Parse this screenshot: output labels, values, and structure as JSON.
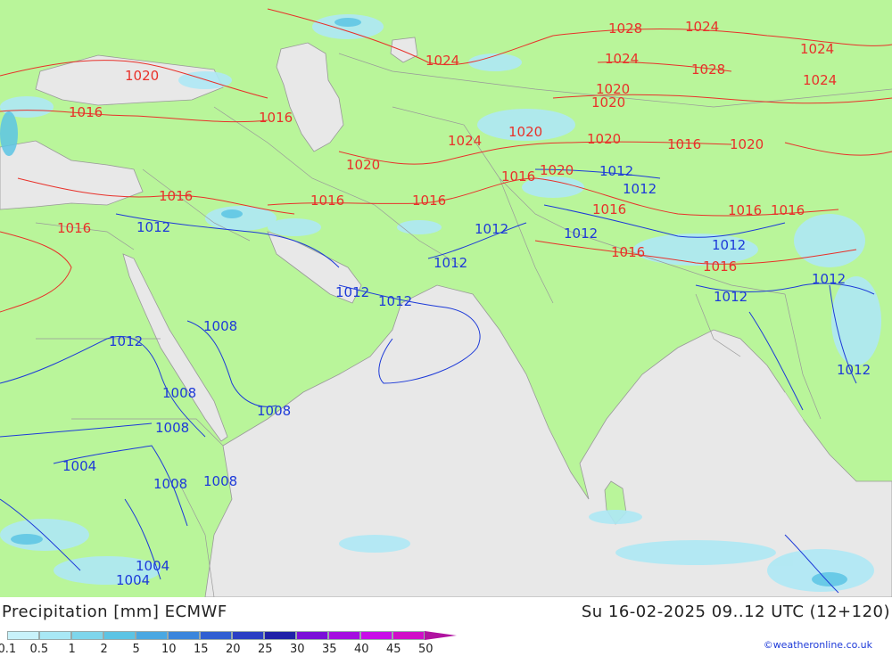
{
  "title": "Precipitation [mm] ECMWF",
  "datetime": "Su 16-02-2025 09..12 UTC (12+120)",
  "credit": "©weatheronline.co.uk",
  "colors": {
    "land": "#b9f59a",
    "sea": "#e8e8e8",
    "isobar_red": "#e8312a",
    "isobar_blue": "#1d3ad8",
    "precip_light": "#aee8f5"
  },
  "legend": {
    "labels": [
      "0.1",
      "0.5",
      "1",
      "2",
      "5",
      "10",
      "15",
      "20",
      "25",
      "30",
      "35",
      "40",
      "45",
      "50"
    ],
    "colors": [
      "#c8f2fa",
      "#a8e8f5",
      "#7ed6ec",
      "#5cc4e4",
      "#4aa8e2",
      "#3a86dc",
      "#2f5fd2",
      "#2a3fc4",
      "#1f22a8",
      "#7a10d8",
      "#a40ee0",
      "#c80ee8",
      "#d00ec8",
      "#b012a0"
    ]
  },
  "isobars_red": [
    "1028",
    "1024",
    "1024",
    "1024",
    "1028",
    "1024",
    "1024",
    "1020",
    "1016",
    "1016",
    "1024",
    "1020",
    "1020",
    "1020",
    "1020",
    "1020",
    "1020",
    "1016",
    "1020",
    "1016",
    "1016",
    "1016",
    "1016",
    "1016",
    "1016",
    "1016",
    "1016",
    "1016",
    "1016"
  ],
  "isobars_blue": [
    "1012",
    "1012",
    "1012",
    "1012",
    "1012",
    "1012",
    "1012",
    "1012",
    "1012",
    "1012",
    "1012",
    "1012",
    "1012",
    "1008",
    "1008",
    "1008",
    "1008",
    "1008",
    "1008",
    "1004",
    "1004",
    "1004"
  ]
}
